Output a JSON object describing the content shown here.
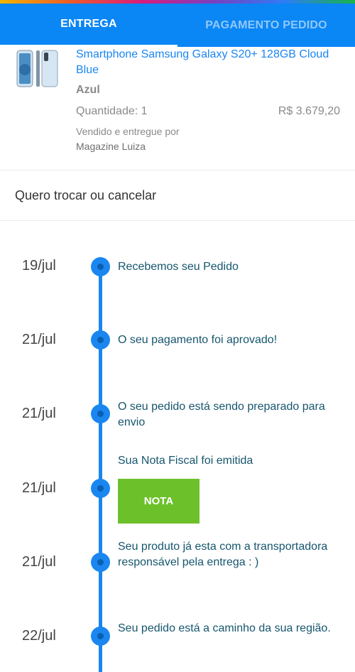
{
  "tabs": [
    {
      "label": "ENTREGA",
      "active": true
    },
    {
      "label": "PAGAMENTO PEDIDO",
      "active": false
    }
  ],
  "colors": {
    "tab_bar": "#0a86f5",
    "accent": "#1a86f0",
    "nota_button": "#6cc12b",
    "status_text": "#16566e"
  },
  "product": {
    "title": "Smartphone Samsung Galaxy S20+ 128GB Cloud Blue",
    "color": "Azul",
    "quantity": "Quantidade: 1",
    "price": "R$ 3.679,20",
    "seller_label": "Vendido e entregue por",
    "seller": "Magazine Luiza",
    "image_icon": "smartphone-image"
  },
  "exchange_link": "Quero trocar ou cancelar",
  "timeline": [
    {
      "date": "19/jul",
      "text": "Recebemos seu Pedido"
    },
    {
      "date": "21/jul",
      "text": "O seu pagamento foi aprovado!"
    },
    {
      "date": "21/jul",
      "text": "O seu pedido está sendo preparado para envio"
    },
    {
      "date": "21/jul",
      "text": "Sua Nota Fiscal foi emitida",
      "button": "NOTA"
    },
    {
      "date": "21/jul",
      "text": "Seu produto já esta com a transportadora responsável pela entrega : )"
    },
    {
      "date": "22/jul",
      "text": "Seu pedido está a caminho da sua região."
    }
  ]
}
